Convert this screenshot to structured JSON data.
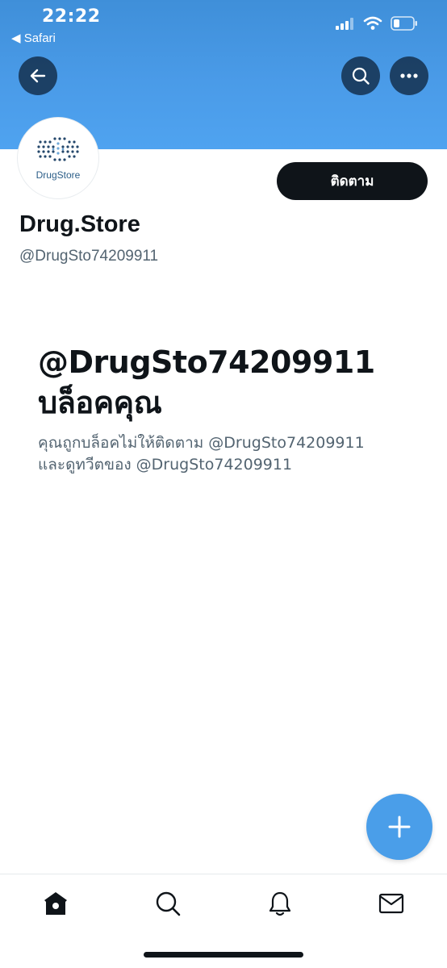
{
  "status_bar": {
    "time": "22:22",
    "back_label": "◀ Safari",
    "icons": [
      "signal-icon",
      "wifi-icon",
      "battery-icon"
    ]
  },
  "header": {
    "banner_color": "#4a9be8",
    "buttons": [
      "back-arrow-icon",
      "search-icon",
      "more-icon"
    ]
  },
  "profile": {
    "avatar_text": "DrugStore",
    "follow_label": "ติดตาม",
    "name": "Drug.Store",
    "handle": "@DrugSto74209911"
  },
  "blocked": {
    "title_line1": "@DrugSto74209911",
    "title_line2": "บล็อคคุณ",
    "desc_line1": "คุณถูกบล็อคไม่ให้ติดตาม @DrugSto74209911",
    "desc_line2": "และดูทวีตของ @DrugSto74209911"
  },
  "fab": {
    "icon": "plus-icon",
    "color": "#4a9ee9"
  },
  "tab_bar": {
    "tabs": [
      "home-icon",
      "search-icon",
      "bell-icon",
      "mail-icon"
    ]
  }
}
